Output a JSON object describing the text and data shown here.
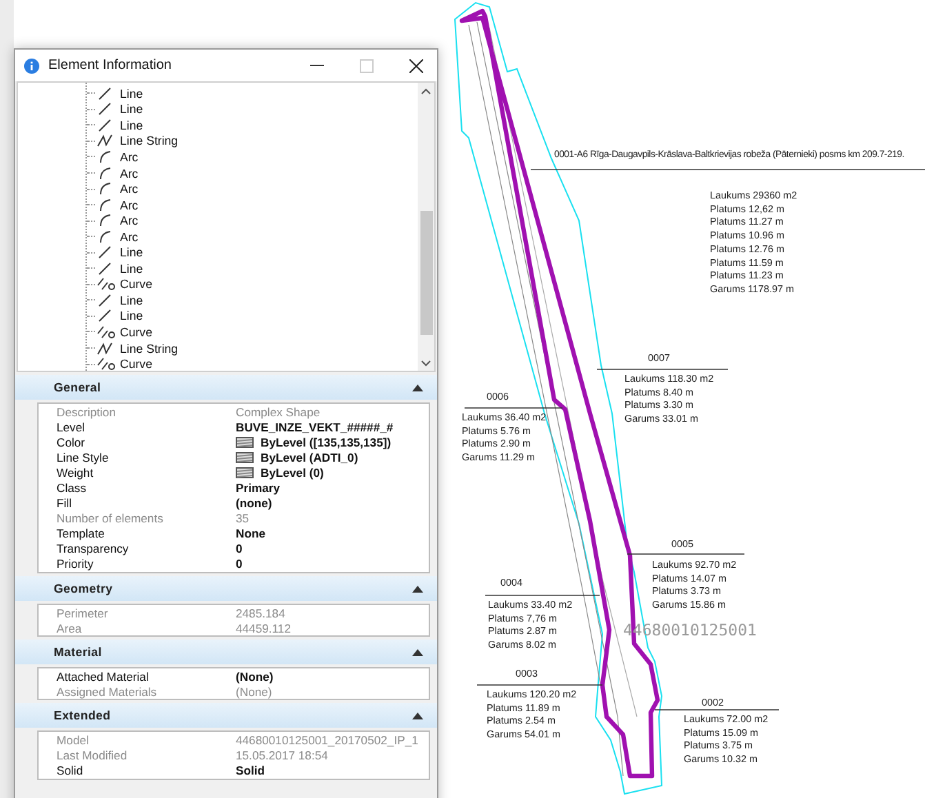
{
  "window": {
    "title": "Element Information"
  },
  "tree": [
    {
      "label": "Line",
      "kind": "line"
    },
    {
      "label": "Line",
      "kind": "line"
    },
    {
      "label": "Line",
      "kind": "line"
    },
    {
      "label": "Line String",
      "kind": "linestring"
    },
    {
      "label": "Arc",
      "kind": "arc"
    },
    {
      "label": "Arc",
      "kind": "arc"
    },
    {
      "label": "Arc",
      "kind": "arc"
    },
    {
      "label": "Arc",
      "kind": "arc"
    },
    {
      "label": "Arc",
      "kind": "arc"
    },
    {
      "label": "Arc",
      "kind": "arc"
    },
    {
      "label": "Line",
      "kind": "line"
    },
    {
      "label": "Line",
      "kind": "line"
    },
    {
      "label": "Curve",
      "kind": "curve"
    },
    {
      "label": "Line",
      "kind": "line"
    },
    {
      "label": "Line",
      "kind": "line"
    },
    {
      "label": "Curve",
      "kind": "curve"
    },
    {
      "label": "Line String",
      "kind": "linestring"
    },
    {
      "label": "Curve",
      "kind": "curve"
    }
  ],
  "sections": [
    {
      "title": "General",
      "expanded": true,
      "rows": [
        {
          "label": "Description",
          "value": "Complex Shape",
          "readonly": true,
          "kind": "text"
        },
        {
          "label": "Level",
          "value": "BUVE_INZE_VEKT_#####_#",
          "readonly": false,
          "kind": "text"
        },
        {
          "label": "Color",
          "value": "ByLevel ([135,135,135])",
          "readonly": false,
          "kind": "swatch"
        },
        {
          "label": "Line Style",
          "value": "ByLevel (ADTI_0)",
          "readonly": false,
          "kind": "swatch"
        },
        {
          "label": "Weight",
          "value": "ByLevel (0)",
          "readonly": false,
          "kind": "swatch"
        },
        {
          "label": "Class",
          "value": "Primary",
          "readonly": false,
          "kind": "text"
        },
        {
          "label": "Fill",
          "value": "(none)",
          "readonly": false,
          "kind": "text"
        },
        {
          "label": "Number of elements",
          "value": "35",
          "readonly": true,
          "kind": "text"
        },
        {
          "label": "Template",
          "value": "None",
          "readonly": false,
          "kind": "text"
        },
        {
          "label": "Transparency",
          "value": "0",
          "readonly": false,
          "kind": "text"
        },
        {
          "label": "Priority",
          "value": "0",
          "readonly": false,
          "kind": "text"
        }
      ]
    },
    {
      "title": "Geometry",
      "expanded": true,
      "rows": [
        {
          "label": "Perimeter",
          "value": "2485.184",
          "readonly": true,
          "kind": "text"
        },
        {
          "label": "Area",
          "value": "44459.112",
          "readonly": true,
          "kind": "text"
        }
      ]
    },
    {
      "title": "Material",
      "expanded": true,
      "rows": [
        {
          "label": "Attached Material",
          "value": "(None)",
          "readonly": false,
          "kind": "text"
        },
        {
          "label": "Assigned Materials",
          "value": "(None)",
          "readonly": true,
          "kind": "text"
        }
      ]
    },
    {
      "title": "Extended",
      "expanded": true,
      "rows": [
        {
          "label": "Model",
          "value": "44680010125001_20170502_IP_1",
          "readonly": true,
          "kind": "text"
        },
        {
          "label": "Last Modified",
          "value": "15.05.2017 18:54",
          "readonly": true,
          "kind": "text"
        },
        {
          "label": "Solid",
          "value": "Solid",
          "readonly": false,
          "kind": "text"
        }
      ]
    }
  ],
  "drawing": {
    "parcel_number": "44680010125001",
    "parcels": [
      {
        "number": "0001-A6 Rīga-Daugavpils-Krāslava-Baltkrievijas robeža (Pāternieki) posms km 209.7-219.",
        "details": [
          "Laukums 29360 m2",
          "Platums  12,62 m",
          "Platums  11.27 m",
          "Platums  10.96 m",
          "Platums 12.76 m",
          "Platums 11.59 m",
          "Platums 11.23 m",
          "Garums  1178.97 m"
        ]
      },
      {
        "number": "0007",
        "details": [
          "Laukums 118.30 m2",
          "Platums 8.40 m",
          "Platums 3.30 m",
          "Garums 33.01 m"
        ]
      },
      {
        "number": "0006",
        "details": [
          "Laukums 36.40 m2",
          "Platums 5.76 m",
          "Platums 2.90 m",
          "Garums 11.29 m"
        ]
      },
      {
        "number": "0005",
        "details": [
          "Laukums 92.70 m2",
          "Platums 14.07 m",
          "Platums 3.73 m",
          "Garums 15.86 m"
        ]
      },
      {
        "number": "0004",
        "details": [
          "Laukums 33.40 m2",
          "Platums 7,76 m",
          "Platums 2.87 m",
          "Garums 8.02 m"
        ]
      },
      {
        "number": "0003",
        "details": [
          "Laukums 120.20 m2",
          "Platums 11.89 m",
          "Platums 2.54 m",
          "Garums 54.01 m"
        ]
      },
      {
        "number": "0002",
        "details": [
          "Laukums 72.00 m2",
          "Platums 15.09 m",
          "Platums 3.75 m",
          "Garums 10.32 m"
        ]
      }
    ]
  }
}
